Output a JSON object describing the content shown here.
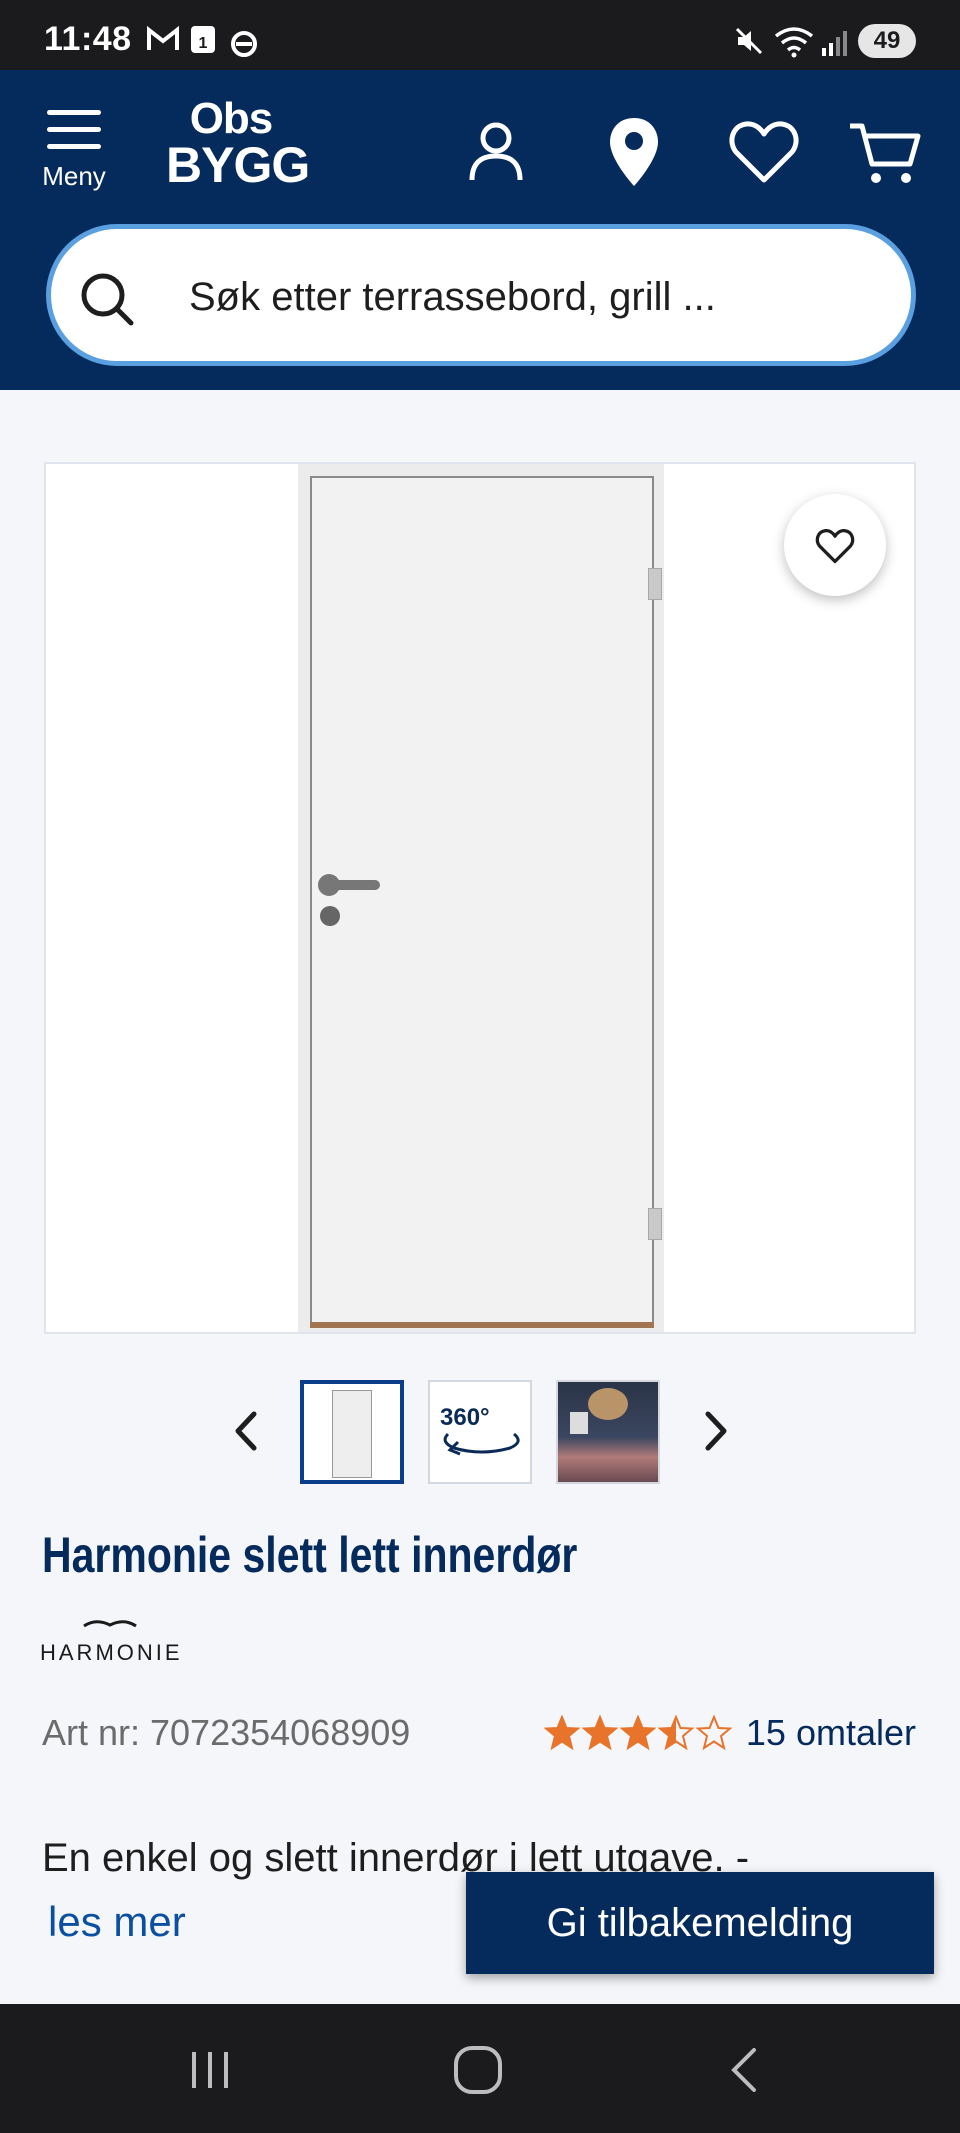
{
  "status_bar": {
    "time": "11:48",
    "battery": "49",
    "notification_icons": [
      "gmail-icon",
      "calendar-icon",
      "sync-icon"
    ],
    "system_icons": [
      "mute-icon",
      "wifi-icon",
      "signal-icon"
    ]
  },
  "header": {
    "menu_label": "Meny",
    "logo_line1": "Obs",
    "logo_line2": "BYGG",
    "icons": [
      "account-icon",
      "store-location-icon",
      "wishlist-icon",
      "cart-icon"
    ],
    "search": {
      "placeholder": "Søk etter terrassebord, grill ..."
    },
    "background_color": "#052a5c",
    "search_border_color": "#5a9fe0"
  },
  "gallery": {
    "thumbnails": [
      "door-photo",
      "360-view",
      "room-photo"
    ],
    "thumbnail_360_label": "360°",
    "active_index": 0
  },
  "product": {
    "title": "Harmonie slett lett innerdør",
    "brand": "HARMONIE",
    "art_nr": "Art nr: 7072354068909",
    "rating": 3.5,
    "rating_max": 5,
    "reviews": "15 omtaler",
    "description": "En enkel og slett innerdør i lett utgave. -",
    "read_more": "les mer"
  },
  "feedback_button": "Gi tilbakemelding",
  "colors": {
    "star": "#e8742b",
    "link": "#0b4fa0",
    "primary": "#052a5c"
  }
}
